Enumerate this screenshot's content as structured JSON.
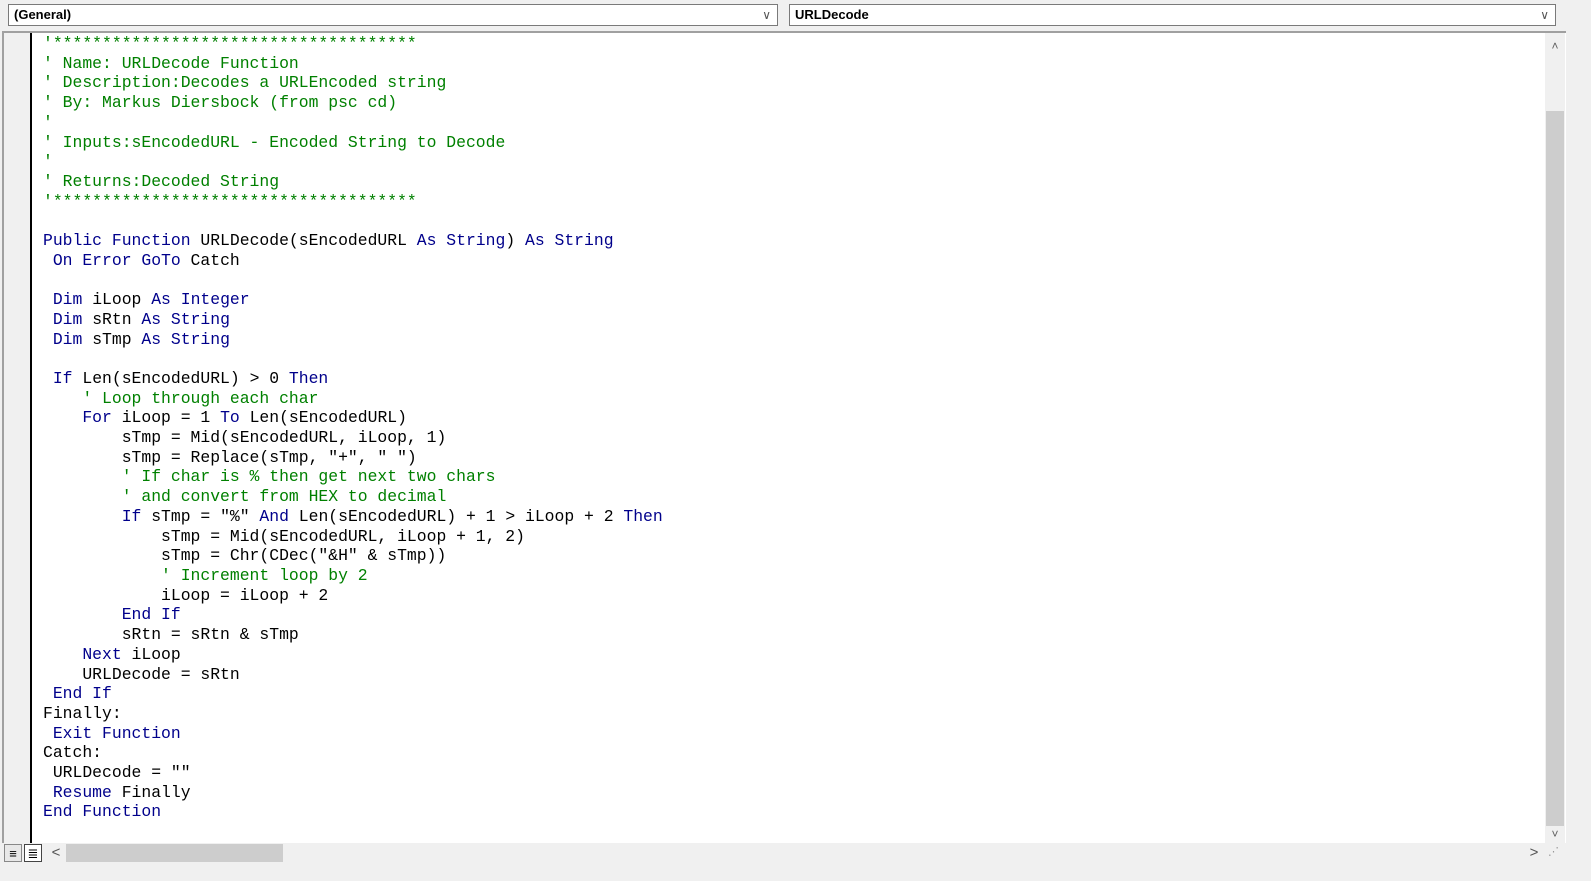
{
  "header": {
    "object_combo": "(General)",
    "procedure_combo": "URLDecode",
    "chevron": "∨"
  },
  "scroll": {
    "up": "˄",
    "down": "˅",
    "left": "<",
    "right": ">",
    "vertical_position": 0
  },
  "view_buttons": {
    "procedure_view": "≡",
    "full_module_view": "≣"
  },
  "colors": {
    "keyword": "#00008b",
    "comment": "#008000",
    "text": "#000000"
  },
  "code": {
    "lines": [
      [
        [
          "'*************************************",
          "cm"
        ]
      ],
      [
        [
          "' Name: URLDecode Function",
          "cm"
        ]
      ],
      [
        [
          "' Description:Decodes a URLEncoded string",
          "cm"
        ]
      ],
      [
        [
          "' By: Markus Diersbock (from psc cd)",
          "cm"
        ]
      ],
      [
        [
          "'",
          "cm"
        ]
      ],
      [
        [
          "' Inputs:sEncodedURL - Encoded String to Decode",
          "cm"
        ]
      ],
      [
        [
          "'",
          "cm"
        ]
      ],
      [
        [
          "' Returns:Decoded String",
          "cm"
        ]
      ],
      [
        [
          "'*************************************",
          "cm"
        ]
      ],
      [
        [
          "",
          ""
        ]
      ],
      [
        [
          "Public Function",
          "kw"
        ],
        [
          " URLDecode(sEncodedURL ",
          "tx"
        ],
        [
          "As String",
          "kw"
        ],
        [
          ") ",
          "tx"
        ],
        [
          "As String",
          "kw"
        ]
      ],
      [
        [
          " On Error GoTo",
          "kw"
        ],
        [
          " Catch",
          "tx"
        ]
      ],
      [
        [
          "",
          ""
        ]
      ],
      [
        [
          " Dim",
          "kw"
        ],
        [
          " iLoop ",
          "tx"
        ],
        [
          "As Integer",
          "kw"
        ]
      ],
      [
        [
          " Dim",
          "kw"
        ],
        [
          " sRtn ",
          "tx"
        ],
        [
          "As String",
          "kw"
        ]
      ],
      [
        [
          " Dim",
          "kw"
        ],
        [
          " sTmp ",
          "tx"
        ],
        [
          "As String",
          "kw"
        ]
      ],
      [
        [
          "",
          ""
        ]
      ],
      [
        [
          " If",
          "kw"
        ],
        [
          " Len(sEncodedURL) > 0 ",
          "tx"
        ],
        [
          "Then",
          "kw"
        ]
      ],
      [
        [
          "    ' Loop through each char",
          "cm"
        ]
      ],
      [
        [
          "    For",
          "kw"
        ],
        [
          " iLoop = 1 ",
          "tx"
        ],
        [
          "To",
          "kw"
        ],
        [
          " Len(sEncodedURL)",
          "tx"
        ]
      ],
      [
        [
          "        sTmp = Mid(sEncodedURL, iLoop, 1)",
          "tx"
        ]
      ],
      [
        [
          "        sTmp = Replace(sTmp, \"+\", \" \")",
          "tx"
        ]
      ],
      [
        [
          "        ' If char is % then get next two chars",
          "cm"
        ]
      ],
      [
        [
          "        ' and convert from HEX to decimal",
          "cm"
        ]
      ],
      [
        [
          "        If",
          "kw"
        ],
        [
          " sTmp = \"%\" ",
          "tx"
        ],
        [
          "And",
          "kw"
        ],
        [
          " Len(sEncodedURL) + 1 > iLoop + 2 ",
          "tx"
        ],
        [
          "Then",
          "kw"
        ]
      ],
      [
        [
          "            sTmp = Mid(sEncodedURL, iLoop + 1, 2)",
          "tx"
        ]
      ],
      [
        [
          "            sTmp = Chr(CDec(\"&H\" & sTmp))",
          "tx"
        ]
      ],
      [
        [
          "            ' Increment loop by 2",
          "cm"
        ]
      ],
      [
        [
          "            iLoop = iLoop + 2",
          "tx"
        ]
      ],
      [
        [
          "        End If",
          "kw"
        ]
      ],
      [
        [
          "        sRtn = sRtn & sTmp",
          "tx"
        ]
      ],
      [
        [
          "    Next",
          "kw"
        ],
        [
          " iLoop",
          "tx"
        ]
      ],
      [
        [
          "    URLDecode = sRtn",
          "tx"
        ]
      ],
      [
        [
          " End If",
          "kw"
        ]
      ],
      [
        [
          "Finally:",
          "tx"
        ]
      ],
      [
        [
          " Exit Function",
          "kw"
        ]
      ],
      [
        [
          "Catch:",
          "tx"
        ]
      ],
      [
        [
          " URLDecode = \"\"",
          "tx"
        ]
      ],
      [
        [
          " Resume",
          "kw"
        ],
        [
          " Finally",
          "tx"
        ]
      ],
      [
        [
          "End Function",
          "kw"
        ]
      ]
    ]
  }
}
